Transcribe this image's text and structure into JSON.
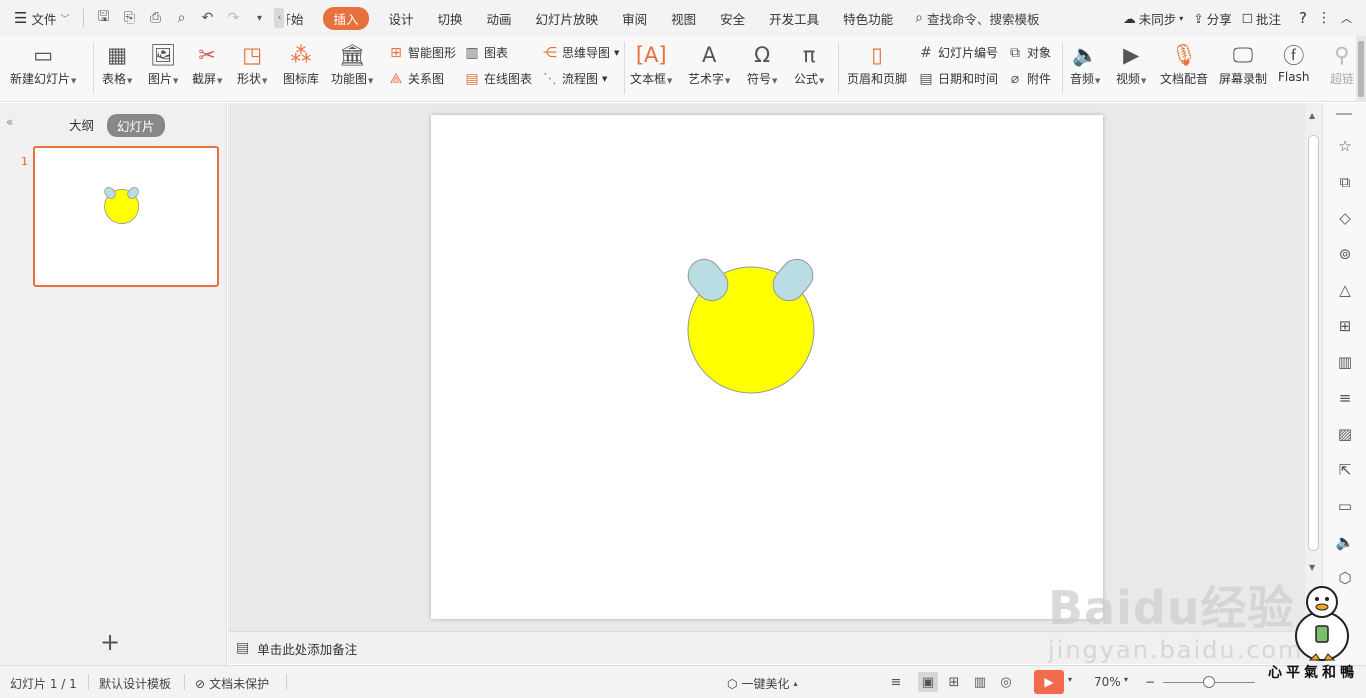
{
  "menubar": {
    "file_label": "文件",
    "tabs": [
      {
        "label": "开始",
        "clipped": true
      },
      {
        "label": "插入",
        "active": true
      },
      {
        "label": "设计"
      },
      {
        "label": "切换"
      },
      {
        "label": "动画"
      },
      {
        "label": "幻灯片放映"
      },
      {
        "label": "审阅"
      },
      {
        "label": "视图"
      },
      {
        "label": "安全"
      },
      {
        "label": "开发工具"
      },
      {
        "label": "特色功能"
      }
    ],
    "search_label": "查找命令、搜索模板",
    "sync_label": "未同步",
    "share_label": "分享",
    "comment_label": "批注",
    "accent_color": "#e8703c"
  },
  "ribbon": {
    "new_slide": "新建幻灯片",
    "table": "表格",
    "picture": "图片",
    "screenshot": "截屏",
    "shape": "形状",
    "icon_lib": "图标库",
    "func_chart": "功能图",
    "smart_art": "智能图形",
    "chart": "图表",
    "relation": "关系图",
    "online_chart": "在线图表",
    "mind_map": "思维导图",
    "flowchart": "流程图",
    "textbox": "文本框",
    "wordart": "艺术字",
    "symbol": "符号",
    "formula": "公式",
    "header_footer": "页眉和页脚",
    "slide_number": "幻灯片编号",
    "object": "对象",
    "date_time": "日期和时间",
    "attachment": "附件",
    "audio": "音频",
    "video": "视频",
    "doc_dub": "文档配音",
    "screen_rec": "屏幕录制",
    "flash": "Flash",
    "hyperlink": "超链"
  },
  "left_panel": {
    "outline_tab": "大纲",
    "slides_tab": "幻灯片",
    "slide_number": "1"
  },
  "slide": {
    "shapes": {
      "face_fill": "#ffff00",
      "ear_fill": "#b9dde2",
      "outline": "#8e9a9c"
    }
  },
  "notes": {
    "placeholder": "单击此处添加备注"
  },
  "statusbar": {
    "slide_info": "幻灯片 1 / 1",
    "template": "默认设计模板",
    "protection": "文档未保护",
    "beautify": "一键美化",
    "zoom": "70%"
  },
  "watermark": {
    "brand": "Baidu经验",
    "url": "jingyan.baidu.com",
    "signature": "心平氣和鴨"
  }
}
